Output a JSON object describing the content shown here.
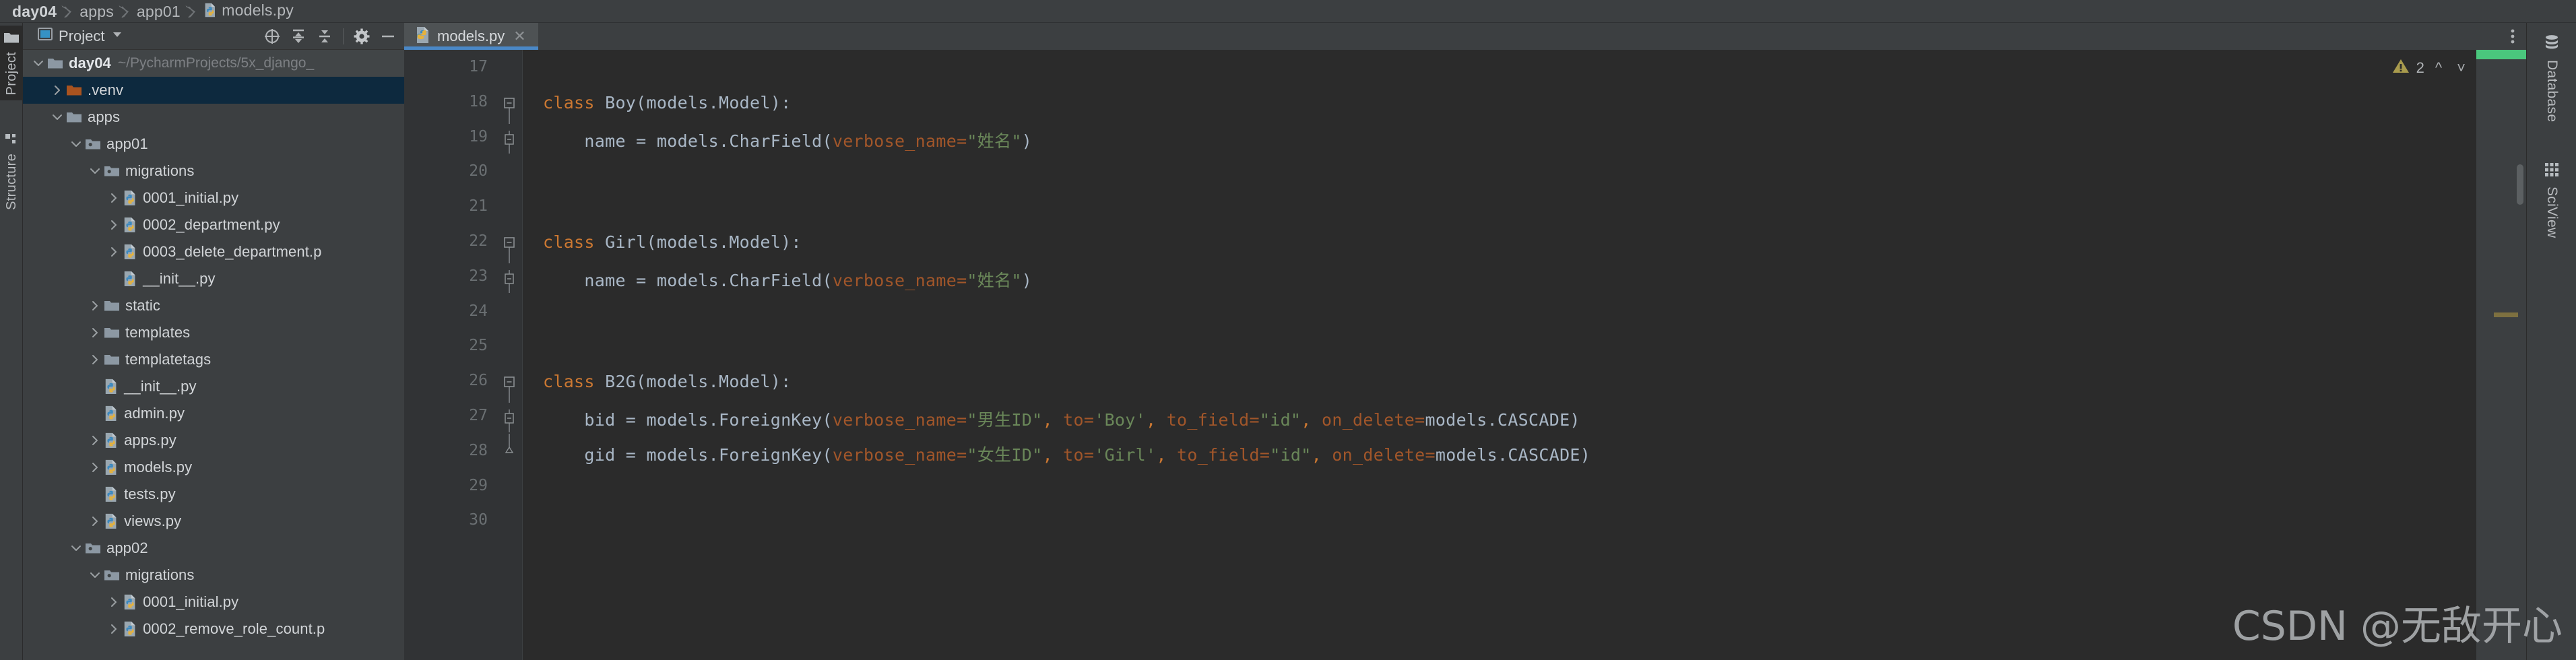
{
  "window": {
    "breadcrumb": [
      {
        "label": "day04",
        "bold": true,
        "icon": null
      },
      {
        "label": "apps",
        "bold": false,
        "icon": null
      },
      {
        "label": "app01",
        "bold": false,
        "icon": null
      },
      {
        "label": "models.py",
        "bold": false,
        "icon": "python-file-icon"
      }
    ]
  },
  "left_rail": {
    "items": [
      {
        "label": "Project",
        "icon": "folder-icon",
        "active": true
      },
      {
        "label": "Structure",
        "icon": "structure-grid-icon",
        "active": false
      }
    ]
  },
  "right_rail": {
    "items": [
      {
        "label": "Database",
        "icon": "database-icon"
      },
      {
        "label": "SciView",
        "icon": "grid-icon"
      }
    ]
  },
  "project_toolbar": {
    "title": "Project",
    "dropdown_icon": "chevron-down-icon",
    "buttons": [
      {
        "name": "select-opened-file-icon",
        "tooltip": "Select Opened File"
      },
      {
        "name": "expand-all-icon",
        "tooltip": "Expand All"
      },
      {
        "name": "collapse-all-icon",
        "tooltip": "Collapse All"
      },
      {
        "name": "settings-gear-icon",
        "tooltip": "Settings"
      },
      {
        "name": "hide-icon",
        "tooltip": "Hide"
      }
    ]
  },
  "tabs": [
    {
      "label": "models.py",
      "icon": "python-file-icon",
      "active": true,
      "close_icon": "close-icon"
    }
  ],
  "tab_bar": {
    "more_icon": "more-vertical-icon"
  },
  "project_tree": [
    {
      "indent": 0,
      "arrow": "down",
      "icon": "folder-icon",
      "name": "day04",
      "bold": true,
      "path": "~/PycharmProjects/5x_django_",
      "selected": false,
      "header": true
    },
    {
      "indent": 1,
      "arrow": "right",
      "icon": "folder-excluded-icon",
      "name": ".venv",
      "bold": false,
      "path": "",
      "selected": true,
      "header": false
    },
    {
      "indent": 1,
      "arrow": "down",
      "icon": "folder-icon",
      "name": "apps",
      "bold": false,
      "path": "",
      "selected": false,
      "header": false
    },
    {
      "indent": 2,
      "arrow": "down",
      "icon": "package-icon",
      "name": "app01",
      "bold": false,
      "path": "",
      "selected": false,
      "header": false
    },
    {
      "indent": 3,
      "arrow": "down",
      "icon": "package-icon",
      "name": "migrations",
      "bold": false,
      "path": "",
      "selected": false,
      "header": false
    },
    {
      "indent": 4,
      "arrow": "right",
      "icon": "python-file-icon",
      "name": "0001_initial.py",
      "bold": false,
      "path": "",
      "selected": false,
      "header": false
    },
    {
      "indent": 4,
      "arrow": "right",
      "icon": "python-file-icon",
      "name": "0002_department.py",
      "bold": false,
      "path": "",
      "selected": false,
      "header": false
    },
    {
      "indent": 4,
      "arrow": "right",
      "icon": "python-file-icon",
      "name": "0003_delete_department.p",
      "bold": false,
      "path": "",
      "selected": false,
      "header": false
    },
    {
      "indent": 4,
      "arrow": "none",
      "icon": "python-file-icon",
      "name": "__init__.py",
      "bold": false,
      "path": "",
      "selected": false,
      "header": false
    },
    {
      "indent": 3,
      "arrow": "right",
      "icon": "folder-icon",
      "name": "static",
      "bold": false,
      "path": "",
      "selected": false,
      "header": false
    },
    {
      "indent": 3,
      "arrow": "right",
      "icon": "folder-icon",
      "name": "templates",
      "bold": false,
      "path": "",
      "selected": false,
      "header": false
    },
    {
      "indent": 3,
      "arrow": "right",
      "icon": "folder-icon",
      "name": "templatetags",
      "bold": false,
      "path": "",
      "selected": false,
      "header": false
    },
    {
      "indent": 3,
      "arrow": "none",
      "icon": "python-file-icon",
      "name": "__init__.py",
      "bold": false,
      "path": "",
      "selected": false,
      "header": false
    },
    {
      "indent": 3,
      "arrow": "none",
      "icon": "python-file-icon",
      "name": "admin.py",
      "bold": false,
      "path": "",
      "selected": false,
      "header": false
    },
    {
      "indent": 3,
      "arrow": "right",
      "icon": "python-file-icon",
      "name": "apps.py",
      "bold": false,
      "path": "",
      "selected": false,
      "header": false
    },
    {
      "indent": 3,
      "arrow": "right",
      "icon": "python-file-icon",
      "name": "models.py",
      "bold": false,
      "path": "",
      "selected": false,
      "header": false
    },
    {
      "indent": 3,
      "arrow": "none",
      "icon": "python-file-icon",
      "name": "tests.py",
      "bold": false,
      "path": "",
      "selected": false,
      "header": false
    },
    {
      "indent": 3,
      "arrow": "right",
      "icon": "python-file-icon",
      "name": "views.py",
      "bold": false,
      "path": "",
      "selected": false,
      "header": false
    },
    {
      "indent": 2,
      "arrow": "down",
      "icon": "package-icon",
      "name": "app02",
      "bold": false,
      "path": "",
      "selected": false,
      "header": false
    },
    {
      "indent": 3,
      "arrow": "down",
      "icon": "package-icon",
      "name": "migrations",
      "bold": false,
      "path": "",
      "selected": false,
      "header": false
    },
    {
      "indent": 4,
      "arrow": "right",
      "icon": "python-file-icon",
      "name": "0001_initial.py",
      "bold": false,
      "path": "",
      "selected": false,
      "header": false
    },
    {
      "indent": 4,
      "arrow": "right",
      "icon": "python-file-icon",
      "name": "0002_remove_role_count.p",
      "bold": false,
      "path": "",
      "selected": false,
      "header": false
    }
  ],
  "editor": {
    "line_numbers": [
      "17",
      "18",
      "19",
      "20",
      "21",
      "22",
      "23",
      "24",
      "25",
      "26",
      "27",
      "28",
      "29",
      "30"
    ],
    "lines": [
      {
        "num": "17",
        "tokens": [],
        "fold": "none"
      },
      {
        "num": "18",
        "fold": "start",
        "tokens": [
          {
            "t": "class ",
            "c": "kw"
          },
          {
            "t": "Boy",
            "c": "cls"
          },
          {
            "t": "(models.Model):",
            "c": "op"
          }
        ]
      },
      {
        "num": "19",
        "fold": "mid",
        "tokens": [
          {
            "t": "    name = models.CharField(",
            "c": "op"
          },
          {
            "t": "verbose_name",
            "c": "kwarg"
          },
          {
            "t": "=",
            "c": "kwarg"
          },
          {
            "t": "\"姓名\"",
            "c": "str"
          },
          {
            "t": ")",
            "c": "op"
          }
        ]
      },
      {
        "num": "20",
        "fold": "none",
        "tokens": []
      },
      {
        "num": "21",
        "fold": "none",
        "tokens": []
      },
      {
        "num": "22",
        "fold": "start",
        "tokens": [
          {
            "t": "class ",
            "c": "kw"
          },
          {
            "t": "Girl",
            "c": "cls"
          },
          {
            "t": "(models.Model):",
            "c": "op"
          }
        ]
      },
      {
        "num": "23",
        "fold": "mid",
        "tokens": [
          {
            "t": "    name = models.CharField(",
            "c": "op"
          },
          {
            "t": "verbose_name",
            "c": "kwarg"
          },
          {
            "t": "=",
            "c": "kwarg"
          },
          {
            "t": "\"姓名\"",
            "c": "str"
          },
          {
            "t": ")",
            "c": "op"
          }
        ]
      },
      {
        "num": "24",
        "fold": "none",
        "tokens": []
      },
      {
        "num": "25",
        "fold": "none",
        "tokens": []
      },
      {
        "num": "26",
        "fold": "start",
        "tokens": [
          {
            "t": "class ",
            "c": "kw"
          },
          {
            "t": "B2G",
            "c": "cls"
          },
          {
            "t": "(models.Model):",
            "c": "op"
          }
        ]
      },
      {
        "num": "27",
        "fold": "mid",
        "tokens": [
          {
            "t": "    bid = models.ForeignKey(",
            "c": "op"
          },
          {
            "t": "verbose_name",
            "c": "kwarg"
          },
          {
            "t": "=",
            "c": "kwarg"
          },
          {
            "t": "\"男生ID\"",
            "c": "str"
          },
          {
            "t": ",",
            "c": "kw"
          },
          {
            "t": " to",
            "c": "kwarg"
          },
          {
            "t": "=",
            "c": "kwarg"
          },
          {
            "t": "'Boy'",
            "c": "str"
          },
          {
            "t": ",",
            "c": "kw"
          },
          {
            "t": " to_field",
            "c": "kwarg"
          },
          {
            "t": "=",
            "c": "kwarg"
          },
          {
            "t": "\"id\"",
            "c": "str"
          },
          {
            "t": ",",
            "c": "kw"
          },
          {
            "t": " on_delete",
            "c": "kwarg"
          },
          {
            "t": "=",
            "c": "kwarg"
          },
          {
            "t": "models.CASCADE)",
            "c": "op"
          }
        ]
      },
      {
        "num": "28",
        "fold": "end",
        "tokens": [
          {
            "t": "    gid = models.ForeignKey(",
            "c": "op"
          },
          {
            "t": "verbose_name",
            "c": "kwarg"
          },
          {
            "t": "=",
            "c": "kwarg"
          },
          {
            "t": "\"女生ID\"",
            "c": "str"
          },
          {
            "t": ",",
            "c": "kw"
          },
          {
            "t": " to",
            "c": "kwarg"
          },
          {
            "t": "=",
            "c": "kwarg"
          },
          {
            "t": "'Girl'",
            "c": "str"
          },
          {
            "t": ",",
            "c": "kw"
          },
          {
            "t": " to_field",
            "c": "kwarg"
          },
          {
            "t": "=",
            "c": "kwarg"
          },
          {
            "t": "\"id\"",
            "c": "str"
          },
          {
            "t": ",",
            "c": "kw"
          },
          {
            "t": " on_delete",
            "c": "kwarg"
          },
          {
            "t": "=",
            "c": "kwarg"
          },
          {
            "t": "models.CASCADE)",
            "c": "op"
          }
        ]
      },
      {
        "num": "29",
        "fold": "none",
        "tokens": []
      },
      {
        "num": "30",
        "fold": "none",
        "tokens": []
      }
    ],
    "inspection": {
      "warning_icon": "warning-triangle-icon",
      "warning_count": "2",
      "prev_icon": "chevron-up-icon",
      "next_icon": "chevron-down-icon"
    }
  },
  "watermark": "CSDN @无敌开心",
  "colors": {
    "editor_bg": "#2b2b2b",
    "panel_bg": "#3c3f41",
    "gutter_bg": "#313335",
    "selection_bg": "#0d293e",
    "tab_active_bg": "#4e5254",
    "tab_underline": "#4a88c7",
    "keyword": "#cc7832",
    "string": "#6a8759",
    "kwarg": "#a1562a",
    "text": "#a9b7c6",
    "warning": "#a99b4d",
    "ok_green": "#4ac77d"
  }
}
